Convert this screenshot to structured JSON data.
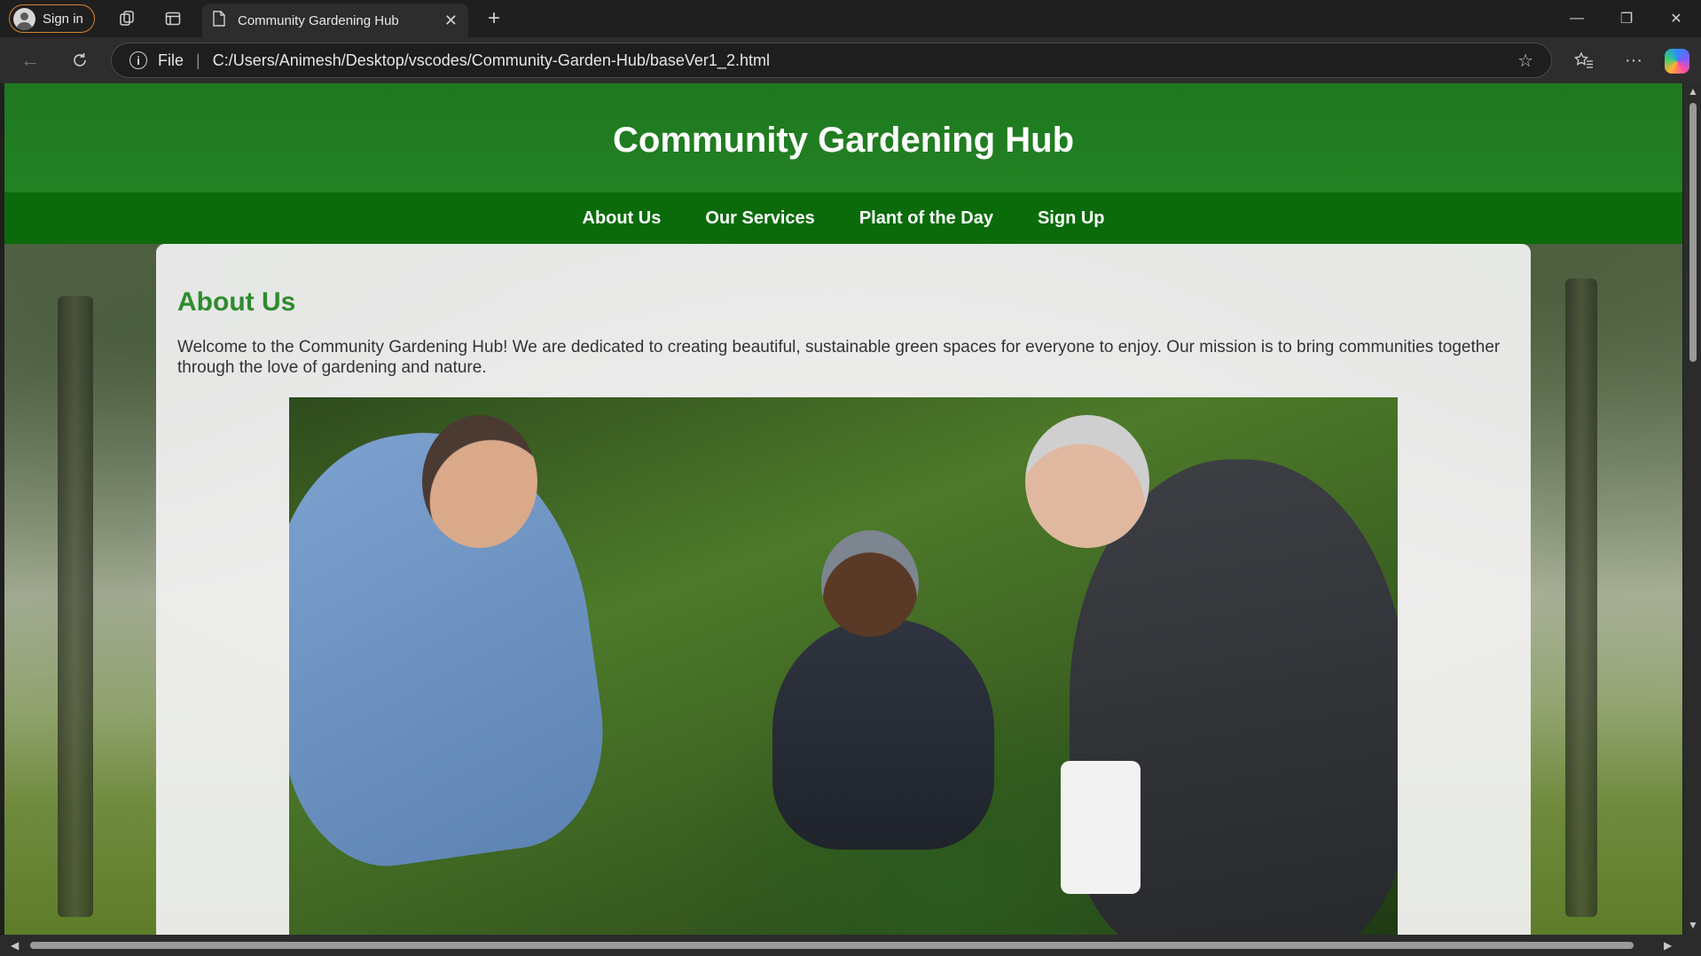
{
  "browser": {
    "signin_label": "Sign in",
    "tab_title": "Community Gardening Hub",
    "tab_close": "✕",
    "new_tab": "+",
    "address_scheme": "File",
    "address_url": "C:/Users/Animesh/Desktop/vscodes/Community-Garden-Hub/baseVer1_2.html",
    "window_controls": {
      "minimize": "—",
      "restore": "❐",
      "close": "✕"
    }
  },
  "page": {
    "site_title": "Community Gardening Hub",
    "nav": [
      "About Us",
      "Our Services",
      "Plant of the Day",
      "Sign Up"
    ],
    "about": {
      "heading": "About Us",
      "text": "Welcome to the Community Gardening Hub! We are dedicated to creating beautiful, sustainable green spaces for everyone to enjoy. Our mission is to bring communities together through the love of gardening and nature."
    }
  },
  "colors": {
    "header_green": "#2a8a2a",
    "nav_green": "#0b6b0b",
    "heading_green": "#2e8b2e",
    "signin_border": "#d9822b"
  }
}
